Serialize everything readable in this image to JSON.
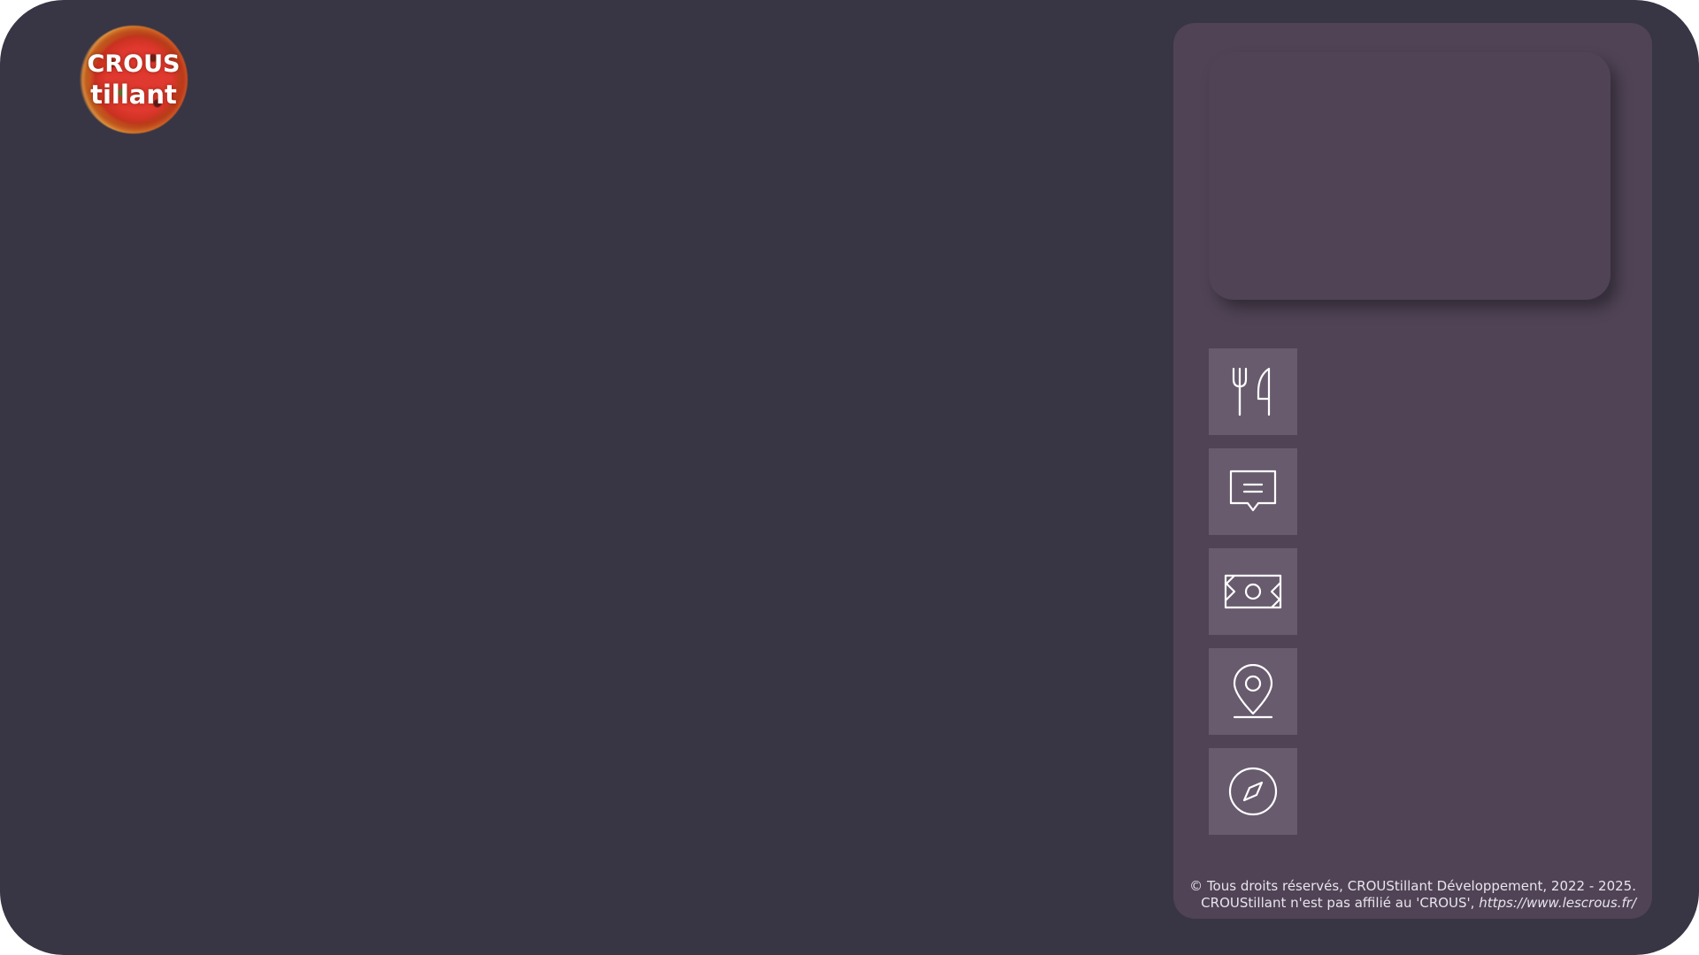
{
  "app": {
    "logo": {
      "line1": "CROUS",
      "line2": "tillant"
    }
  },
  "nav": {
    "items": [
      {
        "name": "restaurants",
        "icon": "fork-knife-icon"
      },
      {
        "name": "chat",
        "icon": "chat-bubble-icon"
      },
      {
        "name": "payment",
        "icon": "banknote-icon"
      },
      {
        "name": "location",
        "icon": "map-pin-icon"
      },
      {
        "name": "explore",
        "icon": "compass-icon"
      }
    ]
  },
  "footer": {
    "line1": "© Tous droits réservés, CROUStillant Développement, 2022 - 2025.",
    "line2_text": "CROUStillant n'est pas affilié au 'CROUS', ",
    "line2_url": "https://www.lescrous.fr/"
  },
  "colors": {
    "background": "#383545",
    "panel": "#4f4355",
    "nav_button": "#685b6e",
    "icon_stroke": "#ffffff"
  }
}
